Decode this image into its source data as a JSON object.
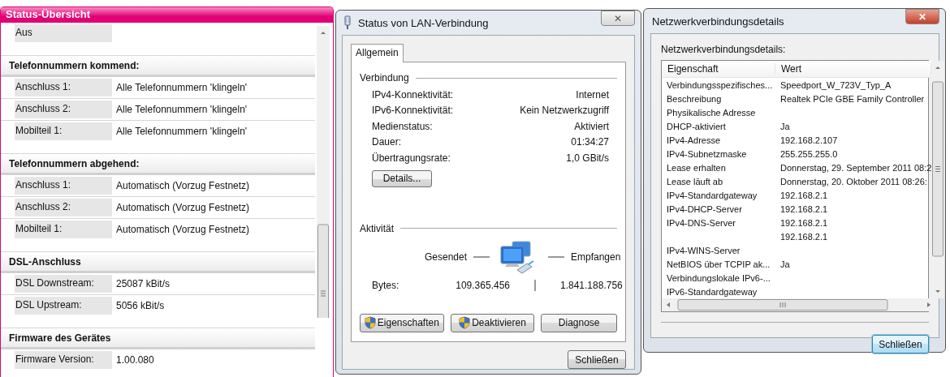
{
  "status_panel": {
    "title": "Status-Übersicht",
    "sections": [
      {
        "rows": [
          {
            "label": "Aus"
          }
        ]
      },
      {
        "heading": "Telefonnummern kommend:",
        "rows": [
          {
            "label": "Anschluss 1:",
            "value": "Alle Telefonnummern 'klingeln'"
          },
          {
            "label": "Anschluss 2:",
            "value": "Alle Telefonnummern 'klingeln'"
          },
          {
            "label": "Mobilteil 1:",
            "value": "Alle Telefonnummern 'klingeln'"
          }
        ]
      },
      {
        "heading": "Telefonnummern abgehend:",
        "rows": [
          {
            "label": "Anschluss 1:",
            "value": "Automatisch (Vorzug Festnetz)"
          },
          {
            "label": "Anschluss 2:",
            "value": "Automatisch (Vorzug Festnetz)"
          },
          {
            "label": "Mobilteil 1:",
            "value": "Automatisch (Vorzug Festnetz)"
          }
        ]
      },
      {
        "heading": "DSL-Anschluss",
        "rows": [
          {
            "label": "DSL Downstream:",
            "value": "25087 kBit/s"
          },
          {
            "label": "DSL Upstream:",
            "value": "5056 kBit/s"
          }
        ]
      },
      {
        "heading": "Firmware des Gerätes",
        "rows": [
          {
            "label": "Firmware Version:",
            "value": "1.00.080"
          }
        ]
      }
    ]
  },
  "lan_dialog": {
    "title": "Status von LAN-Verbindung",
    "close": "✕",
    "tabs": [
      {
        "label": "Allgemein",
        "selected": true
      }
    ],
    "connection": {
      "heading": "Verbindung",
      "rows": [
        {
          "label": "IPv4-Konnektivität:",
          "value": "Internet"
        },
        {
          "label": "IPv6-Konnektivität:",
          "value": "Kein Netzwerkzugriff"
        },
        {
          "label": "Medienstatus:",
          "value": "Aktiviert"
        },
        {
          "label": "Dauer:",
          "value": "01:34:27"
        },
        {
          "label": "Übertragungsrate:",
          "value": "1,0 GBit/s"
        }
      ],
      "details_button": "Details..."
    },
    "activity": {
      "heading": "Aktivität",
      "sent": "Gesendet",
      "received": "Empfangen",
      "bytes_label": "Bytes:",
      "bytes_sent": "109.365.456",
      "bytes_received": "1.841.188.756"
    },
    "buttons": [
      {
        "label": "Eigenschaften",
        "shield": true
      },
      {
        "label": "Deaktivieren",
        "shield": true
      },
      {
        "label": "Diagnose",
        "shield": false
      }
    ],
    "close_button": {
      "label": "Schließen",
      "default": false
    }
  },
  "details_dialog": {
    "title": "Netzwerkverbindungsdetails",
    "close": "✕",
    "caption": "Netzwerkverbindungsdetails:",
    "columns": [
      "Eigenschaft",
      "Wert"
    ],
    "rows": [
      {
        "property": "Verbindungsspezifisches...",
        "value": "Speedport_W_723V_Typ_A"
      },
      {
        "property": "Beschreibung",
        "value": "Realtek PCIe GBE Family Controller"
      },
      {
        "property": "Physikalische Adresse",
        "value": ""
      },
      {
        "property": "DHCP-aktiviert",
        "value": "Ja"
      },
      {
        "property": "IPv4-Adresse",
        "value": "192.168.2.107"
      },
      {
        "property": "IPv4-Subnetzmaske",
        "value": "255.255.255.0"
      },
      {
        "property": "Lease erhalten",
        "value": "Donnerstag, 29. September 2011 08:2"
      },
      {
        "property": "Lease läuft ab",
        "value": "Donnerstag, 20. Oktober 2011 08:26:"
      },
      {
        "property": "IPv4-Standardgateway",
        "value": "192.168.2.1"
      },
      {
        "property": "IPv4-DHCP-Server",
        "value": "192.168.2.1"
      },
      {
        "property": "IPv4-DNS-Server",
        "value": "192.168.2.1"
      },
      {
        "property": "",
        "value": "192.168.2.1"
      },
      {
        "property": "IPv4-WINS-Server",
        "value": ""
      },
      {
        "property": "NetBIOS über TCPIP ak...",
        "value": "Ja"
      },
      {
        "property": "Verbindungslokale IPv6-...",
        "value": ""
      },
      {
        "property": "IPv6-Standardgateway",
        "value": ""
      }
    ],
    "close_button": {
      "label": "Schließen",
      "default": true
    }
  }
}
